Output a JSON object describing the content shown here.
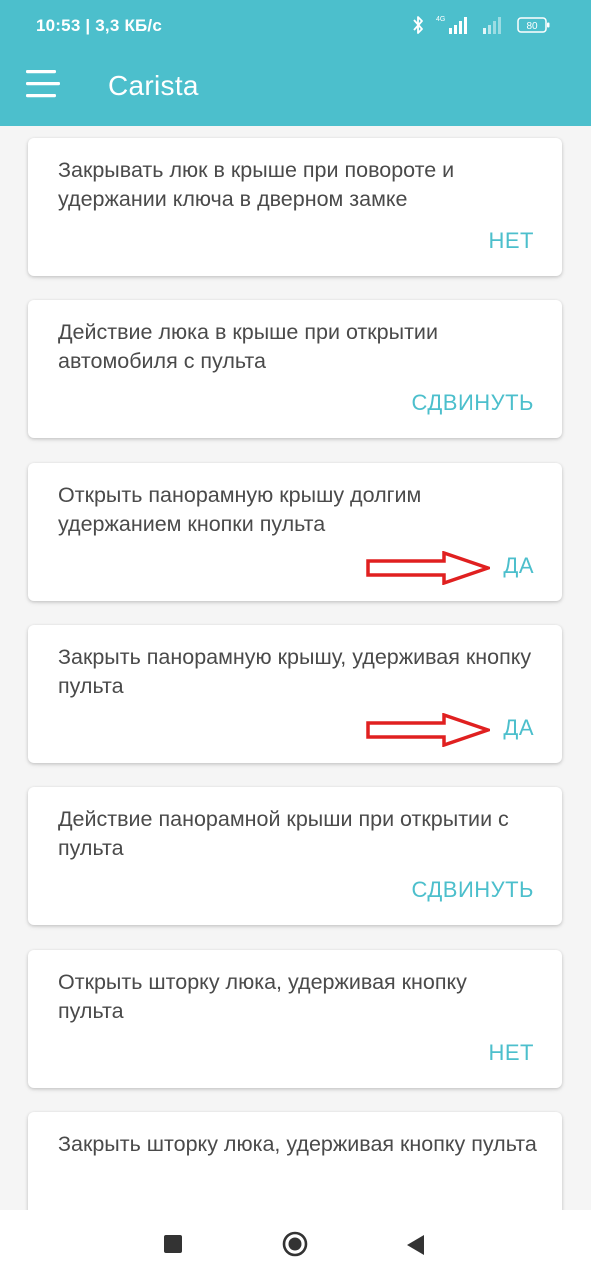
{
  "status_bar": {
    "time": "10:53 | 3,3 КБ/с",
    "network_label": "4G",
    "battery": "80",
    "icons": [
      "bluetooth-icon",
      "signal-icon",
      "signal-icon",
      "battery-icon"
    ]
  },
  "app_bar": {
    "title": "Carista",
    "menu_icon": "hamburger-menu-icon"
  },
  "settings": [
    {
      "title": "Закрывать люк в крыше при повороте и удержании ключа в дверном замке",
      "value": "НЕТ"
    },
    {
      "title": "Действие люка в крыше при открытии автомобиля с пульта",
      "value": "СДВИНУТЬ"
    },
    {
      "title": "Открыть панорамную крышу долгим удержанием кнопки пульта",
      "value": "ДА"
    },
    {
      "title": "Закрыть панорамную крышу, удерживая кнопку пульта",
      "value": "ДА"
    },
    {
      "title": "Действие панорамной крыши при открытии с пульта",
      "value": "СДВИНУТЬ"
    },
    {
      "title": "Открыть шторку люка, удерживая кнопку пульта",
      "value": "НЕТ"
    },
    {
      "title": "Закрыть шторку люка, удерживая кнопку пульта",
      "value": ""
    }
  ],
  "annotation": {
    "arrow_icon": "red-arrow-icon"
  },
  "nav_bar": {
    "icons": [
      "recents-square-icon",
      "home-circle-icon",
      "back-triangle-icon"
    ]
  },
  "colors": {
    "accent": "#4cbfcc",
    "background": "#f5f5f5",
    "card": "#ffffff",
    "title_text": "#4a4a4a",
    "annotation_arrow": "#e02020"
  }
}
